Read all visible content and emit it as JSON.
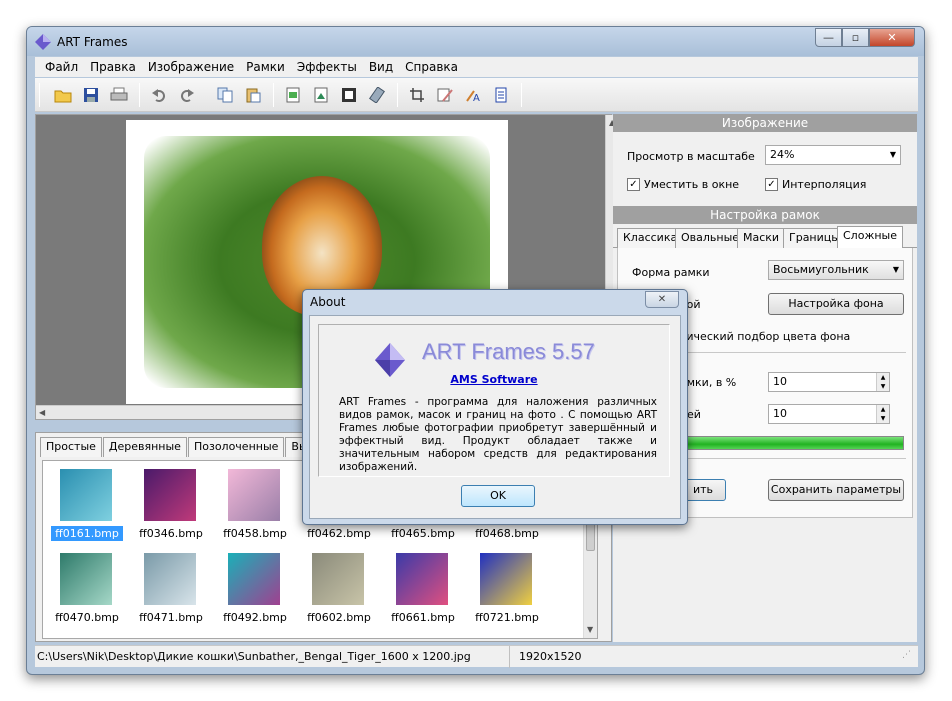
{
  "window": {
    "title": "ART Frames",
    "min_glyph": "—",
    "max_glyph": "▫",
    "close_glyph": "✕"
  },
  "menu": [
    "Файл",
    "Правка",
    "Изображение",
    "Рамки",
    "Эффекты",
    "Вид",
    "Справка"
  ],
  "toolbar_icons": [
    "open-folder-icon",
    "save-icon",
    "print-icon",
    "undo-icon",
    "redo-icon",
    "copy-icon",
    "paste-icon",
    "image-export-icon",
    "image-icon",
    "frame-icon",
    "mask-tool-icon",
    "crop-icon",
    "edit-image-icon",
    "text-icon",
    "settings-page-icon"
  ],
  "image_panel": {
    "header": "Изображение",
    "zoom_label": "Просмотр в масштабе",
    "zoom_value": "24%",
    "fit_label": "Уместить в окне",
    "interp_label": "Интерполяция"
  },
  "frames_panel": {
    "header": "Настройка рамок",
    "tabs": [
      "Классика",
      "Овальные",
      "Маски",
      "Границы",
      "Сложные"
    ],
    "shape_label": "Форма рамки",
    "shape_value": "Восьмиугольник",
    "bg_label_partial": "кой",
    "bg_button": "Настройка фона",
    "auto_color_partial": "тический подбор цвета фона",
    "size_label_partial": "амки, в %",
    "size_value": "10",
    "second_label_partial": "лей",
    "second_value": "10",
    "apply_partial": "ить",
    "save_params": "Сохранить параметры"
  },
  "library": {
    "tabs": [
      "Простые",
      "Деревянные",
      "Позолоченные",
      "Высоко"
    ],
    "thumbs": [
      {
        "name": "ff0161.bmp",
        "c1": "#2a8fb0",
        "c2": "#7fd0e0",
        "selected": true
      },
      {
        "name": "ff0346.bmp",
        "c1": "#4a1a6a",
        "c2": "#c03a7a",
        "selected": false
      },
      {
        "name": "ff0458.bmp",
        "c1": "#f2b8d8",
        "c2": "#9a7fa8",
        "selected": false
      },
      {
        "name": "ff0462.bmp",
        "c1": "#9bb8d0",
        "c2": "#d0d8e4",
        "selected": false
      },
      {
        "name": "ff0465.bmp",
        "c1": "#cfd8e0",
        "c2": "#eef2f4",
        "selected": false
      },
      {
        "name": "ff0468.bmp",
        "c1": "#d8dde2",
        "c2": "#f4f6f8",
        "selected": false
      },
      {
        "name": "ff0470.bmp",
        "c1": "#2e7a6a",
        "c2": "#a6d8c8",
        "selected": false
      },
      {
        "name": "ff0471.bmp",
        "c1": "#7a9aa8",
        "c2": "#d8e4ea",
        "selected": false
      },
      {
        "name": "ff0492.bmp",
        "c1": "#1ab0b8",
        "c2": "#a04090",
        "selected": false
      },
      {
        "name": "ff0602.bmp",
        "c1": "#8a8a7a",
        "c2": "#c8c4a8",
        "selected": false
      },
      {
        "name": "ff0661.bmp",
        "c1": "#3a3aa8",
        "c2": "#e05080",
        "selected": false
      },
      {
        "name": "ff0721.bmp",
        "c1": "#2030c0",
        "c2": "#f0d040",
        "selected": false
      }
    ]
  },
  "status": {
    "path": "C:\\Users\\Nik\\Desktop\\Дикие кошки\\Sunbather,_Bengal_Tiger_1600 x 1200.jpg",
    "dimensions": "1920x1520"
  },
  "about": {
    "title": "About",
    "close_glyph": "✕",
    "app_name": "ART Frames 5.57",
    "company": "AMS Software",
    "description": "ART Frames - программа для наложения различных видов рамок, масок и границ на фото . С помощью ART Frames любые фотографии приобретут завершённый и эффектный вид. Продукт обладает также и значительным набором средств для редактирования изображений.",
    "ok": "OK"
  },
  "colors": {
    "accent_blue": "#3399ff",
    "header_gray": "#a0a0a0",
    "progress_green": "#22b322",
    "about_title": "#8a8ad8"
  }
}
